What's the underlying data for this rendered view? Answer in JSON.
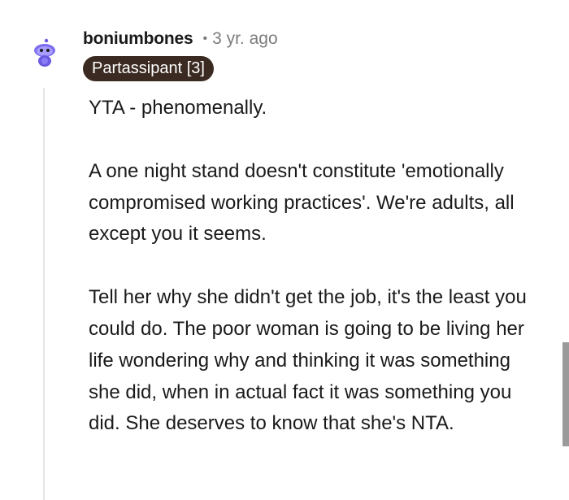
{
  "comment": {
    "username": "boniumbones",
    "separator": "•",
    "timestamp": "3 yr. ago",
    "flair": "Partassipant [3]",
    "paragraphs": [
      "YTA - phenomenally.",
      "A one night stand doesn't constitute 'emotionally compromised working practices'. We're adults, all except you it seems.",
      "Tell her why she didn't get the job, it's the least you could do. The poor woman is going to be living her life wondering why and thinking it was something she did, when in actual fact it was something you did. She deserves to know that she's NTA."
    ]
  },
  "icons": {
    "avatar": "snoo-avatar-icon"
  },
  "colors": {
    "text": "#1a1a1b",
    "meta": "#7c7c7c",
    "flair_bg": "#3b2a21",
    "flair_text": "#ffffff",
    "thread_line": "#e5e5e5",
    "avatar": "#6a5ae0"
  }
}
